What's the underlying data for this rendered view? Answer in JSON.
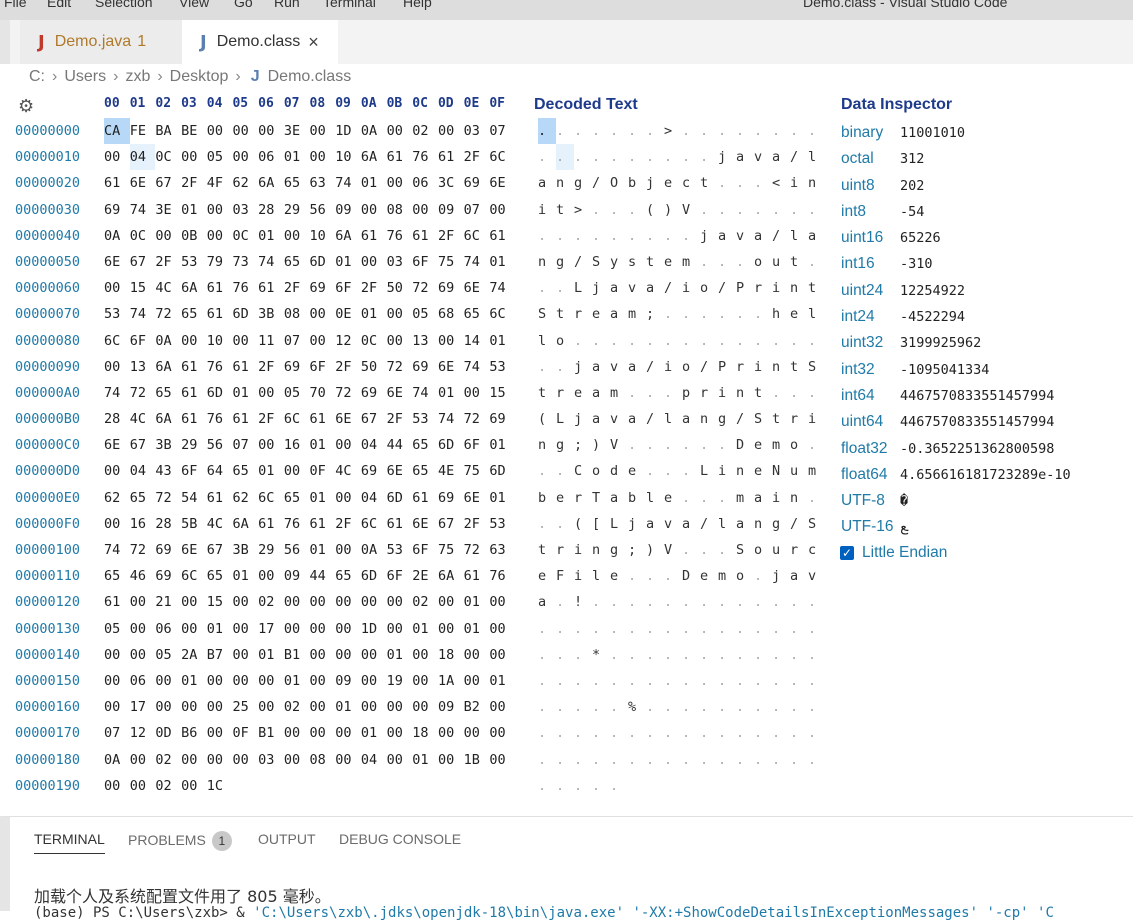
{
  "menu": {
    "items": [
      "File",
      "Edit",
      "Selection",
      "View",
      "Go",
      "Run",
      "Terminal",
      "Help"
    ],
    "window_title": "Demo.class - Visual Studio Code"
  },
  "tabs": {
    "inactive": {
      "label": "Demo.java",
      "badge": "1",
      "icon": "J"
    },
    "active": {
      "label": "Demo.class",
      "icon": "J",
      "close": "×"
    }
  },
  "breadcrumb": {
    "parts": [
      "C:",
      "Users",
      "zxb",
      "Desktop"
    ],
    "file": "Demo.class",
    "sep": "›"
  },
  "hex_header": [
    "00",
    "01",
    "02",
    "03",
    "04",
    "05",
    "06",
    "07",
    "08",
    "09",
    "0A",
    "0B",
    "0C",
    "0D",
    "0E",
    "0F"
  ],
  "decoded_title": "Decoded Text",
  "inspector_title": "Data Inspector",
  "rows": [
    {
      "offset": "00000000",
      "hex": "CA FE BA BE 00 00 00 3E 00 1D 0A 00 02 00 03 07",
      "text": ". . . . . . . > . . . . . . . ."
    },
    {
      "offset": "00000010",
      "hex": "00 04 0C 00 05 00 06 01 00 10 6A 61 76 61 2F 6C",
      "text": ". . . . . . . . . . j a v a / l"
    },
    {
      "offset": "00000020",
      "hex": "61 6E 67 2F 4F 62 6A 65 63 74 01 00 06 3C 69 6E",
      "text": "a n g / O b j e c t . . . < i n"
    },
    {
      "offset": "00000030",
      "hex": "69 74 3E 01 00 03 28 29 56 09 00 08 00 09 07 00",
      "text": "i t > . . . ( ) V . . . . . . ."
    },
    {
      "offset": "00000040",
      "hex": "0A 0C 00 0B 00 0C 01 00 10 6A 61 76 61 2F 6C 61",
      "text": ". . . . . . . . . j a v a / l a"
    },
    {
      "offset": "00000050",
      "hex": "6E 67 2F 53 79 73 74 65 6D 01 00 03 6F 75 74 01",
      "text": "n g / S y s t e m . . . o u t ."
    },
    {
      "offset": "00000060",
      "hex": "00 15 4C 6A 61 76 61 2F 69 6F 2F 50 72 69 6E 74",
      "text": ". . L j a v a / i o / P r i n t"
    },
    {
      "offset": "00000070",
      "hex": "53 74 72 65 61 6D 3B 08 00 0E 01 00 05 68 65 6C",
      "text": "S t r e a m ; . . . . . . h e l"
    },
    {
      "offset": "00000080",
      "hex": "6C 6F 0A 00 10 00 11 07 00 12 0C 00 13 00 14 01",
      "text": "l o . . . . . . . . . . . . . ."
    },
    {
      "offset": "00000090",
      "hex": "00 13 6A 61 76 61 2F 69 6F 2F 50 72 69 6E 74 53",
      "text": ". . j a v a / i o / P r i n t S"
    },
    {
      "offset": "000000A0",
      "hex": "74 72 65 61 6D 01 00 05 70 72 69 6E 74 01 00 15",
      "text": "t r e a m . . . p r i n t . . ."
    },
    {
      "offset": "000000B0",
      "hex": "28 4C 6A 61 76 61 2F 6C 61 6E 67 2F 53 74 72 69",
      "text": "( L j a v a / l a n g / S t r i"
    },
    {
      "offset": "000000C0",
      "hex": "6E 67 3B 29 56 07 00 16 01 00 04 44 65 6D 6F 01",
      "text": "n g ; ) V . . . . . . D e m o ."
    },
    {
      "offset": "000000D0",
      "hex": "00 04 43 6F 64 65 01 00 0F 4C 69 6E 65 4E 75 6D",
      "text": ". . C o d e . . . L i n e N u m"
    },
    {
      "offset": "000000E0",
      "hex": "62 65 72 54 61 62 6C 65 01 00 04 6D 61 69 6E 01",
      "text": "b e r T a b l e . . . m a i n ."
    },
    {
      "offset": "000000F0",
      "hex": "00 16 28 5B 4C 6A 61 76 61 2F 6C 61 6E 67 2F 53",
      "text": ". . ( [ L j a v a / l a n g / S"
    },
    {
      "offset": "00000100",
      "hex": "74 72 69 6E 67 3B 29 56 01 00 0A 53 6F 75 72 63",
      "text": "t r i n g ; ) V . . . S o u r c"
    },
    {
      "offset": "00000110",
      "hex": "65 46 69 6C 65 01 00 09 44 65 6D 6F 2E 6A 61 76",
      "text": "e F i l e . . . D e m o . j a v"
    },
    {
      "offset": "00000120",
      "hex": "61 00 21 00 15 00 02 00 00 00 00 00 02 00 01 00",
      "text": "a . ! . . . . . . . . . . . . ."
    },
    {
      "offset": "00000130",
      "hex": "05 00 06 00 01 00 17 00 00 00 1D 00 01 00 01 00",
      "text": ". . . . . . . . . . . . . . . ."
    },
    {
      "offset": "00000140",
      "hex": "00 00 05 2A B7 00 01 B1 00 00 00 01 00 18 00 00",
      "text": ". . . * . . . . . . . . . . . ."
    },
    {
      "offset": "00000150",
      "hex": "00 06 00 01 00 00 00 01 00 09 00 19 00 1A 00 01",
      "text": ". . . . . . . . . . . . . . . ."
    },
    {
      "offset": "00000160",
      "hex": "00 17 00 00 00 25 00 02 00 01 00 00 00 09 B2 00",
      "text": ". . . . . % . . . . . . . . . ."
    },
    {
      "offset": "00000170",
      "hex": "07 12 0D B6 00 0F B1 00 00 00 01 00 18 00 00 00",
      "text": ". . . . . . . . . . . . . . . ."
    },
    {
      "offset": "00000180",
      "hex": "0A 00 02 00 00 00 03 00 08 00 04 00 01 00 1B 00",
      "text": ". . . . . . . . . . . . . . . ."
    },
    {
      "offset": "00000190",
      "hex": "00 00 02 00 1C",
      "text": ". . . . ."
    }
  ],
  "inspector": [
    {
      "label": "binary",
      "value": "11001010"
    },
    {
      "label": "octal",
      "value": "312"
    },
    {
      "label": "uint8",
      "value": "202"
    },
    {
      "label": "int8",
      "value": "-54"
    },
    {
      "label": "uint16",
      "value": "65226"
    },
    {
      "label": "int16",
      "value": "-310"
    },
    {
      "label": "uint24",
      "value": "12254922"
    },
    {
      "label": "int24",
      "value": "-4522294"
    },
    {
      "label": "uint32",
      "value": "3199925962"
    },
    {
      "label": "int32",
      "value": "-1095041334"
    },
    {
      "label": "int64",
      "value": "4467570833551457994"
    },
    {
      "label": "uint64",
      "value": "4467570833551457994"
    },
    {
      "label": "float32",
      "value": "-0.3652251362800598"
    },
    {
      "label": "float64",
      "value": "4.656616181723289e-10"
    },
    {
      "label": "UTF-8",
      "value": "�"
    },
    {
      "label": "UTF-16",
      "value": "ﻊ"
    }
  ],
  "endian": {
    "label": "Little Endian",
    "checked": true
  },
  "panel": {
    "tabs": [
      "TERMINAL",
      "PROBLEMS",
      "OUTPUT",
      "DEBUG CONSOLE"
    ],
    "problems_badge": "1",
    "line1": "加载个人及系统配置文件用了 805 毫秒。",
    "line2_prefix": "(base) PS C:\\Users\\zxb>  & ",
    "line2_str": "'C:\\Users\\zxb\\.jdks\\openjdk-18\\bin\\java.exe' '-XX:+ShowCodeDetailsInExceptionMessages' '-cp' 'C"
  }
}
